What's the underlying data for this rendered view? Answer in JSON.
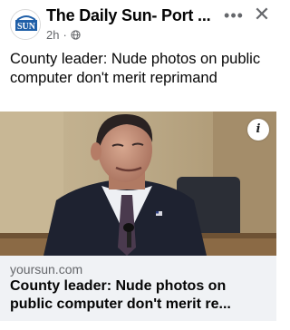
{
  "post": {
    "page_name": "The Daily Sun- Port ...",
    "avatar_text": "SUN",
    "time": "2h",
    "privacy_icon": "globe-icon",
    "more_icon": "more-horizontal-icon",
    "close_icon": "close-icon",
    "caption": "County leader: Nude photos on public computer don't merit reprimand"
  },
  "photo": {
    "info_icon": "info-icon",
    "info_label": "i"
  },
  "link": {
    "domain": "yoursun.com",
    "title": "County leader: Nude photos on public computer don't merit re..."
  },
  "colors": {
    "text": "#050505",
    "secondary": "#65676b",
    "link_background": "#f0f2f5",
    "brand_blue": "#1f5fa8"
  }
}
